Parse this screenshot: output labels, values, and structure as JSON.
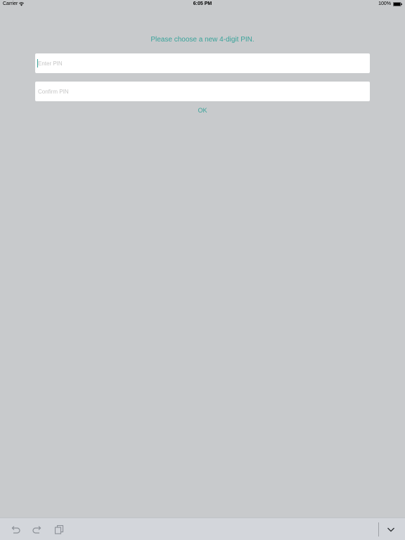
{
  "status_bar": {
    "carrier": "Carrier",
    "time": "6:05 PM",
    "battery": "100%",
    "icons": [
      "wifi-icon",
      "battery-icon"
    ]
  },
  "form": {
    "prompt": "Please choose a new 4-digit PIN.",
    "enter_pin": {
      "placeholder": "Enter PIN",
      "value": ""
    },
    "confirm_pin": {
      "placeholder": "Confirm PIN",
      "value": ""
    },
    "ok_label": "OK"
  },
  "keyboard_accessory": {
    "icons": [
      "undo-icon",
      "redo-icon",
      "paste-icon",
      "chevron-down-icon"
    ]
  },
  "colors": {
    "background": "#c8cacc",
    "accent": "#3aa39a",
    "field_background": "#ffffff",
    "accessory_bar": "#d3d6db"
  }
}
